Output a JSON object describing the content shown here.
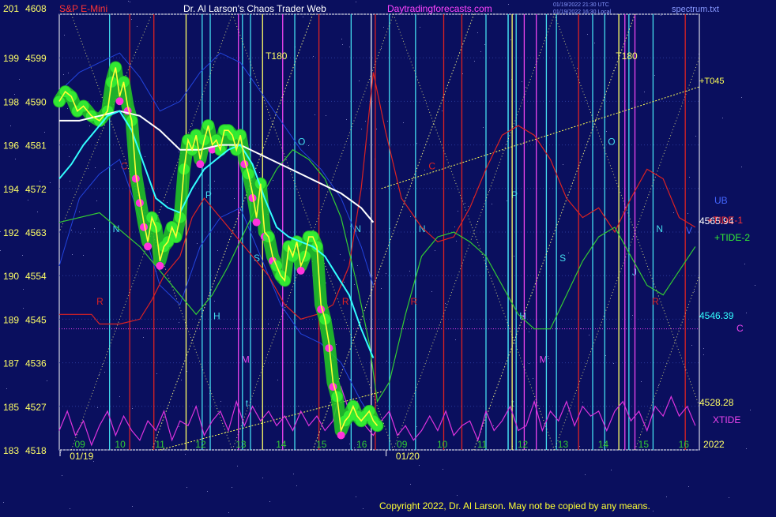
{
  "header": {
    "symbol": "S&P E-Mini",
    "title": "Dr. Al Larson's Chaos Trader Web",
    "site": "Daytradingforecasts.com",
    "stamp1": "01/19/2022 21:30 UTC",
    "stamp2": "01/19/2022 16:30 Local",
    "file": "spectrum.txt"
  },
  "footer": {
    "copyright": "Copyright 2022, Dr. Al Larson. May not be copied by any means."
  },
  "colors": {
    "background": "#0a0f5e",
    "grid": "#2a3a9a",
    "price": "#ffff33",
    "halo": "#22cc22",
    "ma_fast": "#33ffff",
    "ma_slow": "#ffffff",
    "tide1": "#dd2222",
    "tide2": "#33cc33",
    "xtide": "#dd33dd",
    "band": "#2244dd",
    "sun_line": "#44ddee",
    "moon_line": "#ee44ee",
    "mercury_line": "#dd2222",
    "venus_line": "#ffff66"
  },
  "chart_data": {
    "type": "line",
    "title": "S&P E-Mini",
    "y_left_ticks": [
      "183",
      "185",
      "187",
      "189",
      "190",
      "192",
      "194",
      "196",
      "198",
      "199",
      "201"
    ],
    "y_price_ticks": [
      4518,
      4527,
      4536,
      4545,
      4554,
      4563,
      4572,
      4581,
      4590,
      4599,
      4608
    ],
    "ylim": [
      4518,
      4608
    ],
    "x_hour_labels": [
      {
        "t": 0.5,
        "label": "09"
      },
      {
        "t": 1.5,
        "label": "10"
      },
      {
        "t": 2.5,
        "label": "11"
      },
      {
        "t": 3.5,
        "label": "12"
      },
      {
        "t": 4.5,
        "label": "13"
      },
      {
        "t": 5.5,
        "label": "14"
      },
      {
        "t": 6.5,
        "label": "15"
      },
      {
        "t": 7.5,
        "label": "16"
      },
      {
        "t": 8.5,
        "label": "09"
      },
      {
        "t": 9.5,
        "label": "10"
      },
      {
        "t": 10.5,
        "label": "11"
      },
      {
        "t": 11.5,
        "label": "12"
      },
      {
        "t": 12.5,
        "label": "13"
      },
      {
        "t": 13.5,
        "label": "14"
      },
      {
        "t": 14.5,
        "label": "15"
      },
      {
        "t": 15.5,
        "label": "16"
      }
    ],
    "x_range": [
      0,
      15.9
    ],
    "dates": [
      {
        "t": 0.3,
        "label": "01/19"
      },
      {
        "t": 8.4,
        "label": "01/20"
      }
    ],
    "year": "2022",
    "price": {
      "name": "price",
      "x": [
        0,
        0.15,
        0.3,
        0.45,
        0.6,
        0.8,
        1.0,
        1.2,
        1.3,
        1.4,
        1.5,
        1.6,
        1.7,
        1.8,
        1.9,
        2.0,
        2.1,
        2.2,
        2.3,
        2.4,
        2.5,
        2.6,
        2.7,
        2.8,
        2.9,
        3.0,
        3.1,
        3.2,
        3.3,
        3.4,
        3.5,
        3.6,
        3.7,
        3.8,
        3.9,
        4.0,
        4.1,
        4.2,
        4.3,
        4.4,
        4.5,
        4.6,
        4.7,
        4.8,
        4.9,
        5.0,
        5.1,
        5.2,
        5.3,
        5.4,
        5.5,
        5.6,
        5.7,
        5.8,
        5.9,
        6.0,
        6.1,
        6.2,
        6.3,
        6.4,
        6.5,
        6.6,
        6.7,
        6.8,
        6.9,
        7.0,
        7.1,
        7.2,
        7.3,
        7.4,
        7.5,
        7.6,
        7.7,
        7.8,
        7.9
      ],
      "y": [
        4590,
        4592,
        4591,
        4588,
        4589,
        4587,
        4586,
        4588,
        4594,
        4597,
        4591,
        4594,
        4589,
        4586,
        4575,
        4570,
        4565,
        4561,
        4566,
        4564,
        4557,
        4560,
        4561,
        4564,
        4562,
        4566,
        4576,
        4582,
        4580,
        4583,
        4578,
        4582,
        4585,
        4581,
        4582,
        4580,
        4584,
        4584,
        4583,
        4580,
        4583,
        4578,
        4575,
        4571,
        4566,
        4573,
        4563,
        4562,
        4558,
        4556,
        4554,
        4553,
        4560,
        4558,
        4561,
        4556,
        4558,
        4562,
        4562,
        4560,
        4548,
        4545,
        4540,
        4532,
        4529,
        4522,
        4524,
        4525,
        4527,
        4525,
        4524,
        4525,
        4526,
        4524,
        4523
      ]
    },
    "ma_fast": {
      "name": "ma_fast",
      "x": [
        0,
        0.3,
        0.6,
        0.9,
        1.2,
        1.5,
        1.8,
        2.1,
        2.4,
        2.7,
        3.0,
        3.3,
        3.6,
        3.9,
        4.2,
        4.5,
        4.8,
        5.1,
        5.4,
        5.7,
        6.0,
        6.3,
        6.6,
        6.9,
        7.2,
        7.5,
        7.8
      ],
      "y": [
        4574,
        4577,
        4581,
        4584,
        4587,
        4588,
        4584,
        4577,
        4570,
        4568,
        4567,
        4572,
        4576,
        4578,
        4580,
        4581,
        4577,
        4570,
        4564,
        4562,
        4561,
        4560,
        4558,
        4554,
        4550,
        4543,
        4537
      ]
    },
    "ma_slow": {
      "name": "ma_slow",
      "x": [
        0,
        0.5,
        1.0,
        1.5,
        2.0,
        2.5,
        3.0,
        3.5,
        4.0,
        4.5,
        5.0,
        5.5,
        6.0,
        6.5,
        7.0,
        7.5,
        7.8
      ],
      "y": [
        4586,
        4586,
        4587,
        4588,
        4587,
        4584,
        4580,
        4580,
        4581,
        4581,
        4579,
        4577,
        4575,
        4573,
        4571,
        4568,
        4565
      ]
    },
    "tide1": {
      "name": "+TIDE-1",
      "x": [
        0,
        0.8,
        1.0,
        1.5,
        2.0,
        2.3,
        2.6,
        3.0,
        3.3,
        3.6,
        4.0,
        4.4,
        4.8,
        5.2,
        5.6,
        6.0,
        6.4,
        6.8,
        7.2,
        7.5,
        7.8,
        8.1,
        8.5,
        9.0,
        9.4,
        9.8,
        10.2,
        10.6,
        11.0,
        11.4,
        11.8,
        12.2,
        12.6,
        13.0,
        13.4,
        13.8,
        14.2,
        14.6,
        15.0,
        15.4,
        15.8
      ],
      "y": [
        4546,
        4546,
        4544,
        4544,
        4545,
        4549,
        4554,
        4558,
        4566,
        4570,
        4566,
        4562,
        4558,
        4554,
        4548,
        4545,
        4546,
        4548,
        4556,
        4572,
        4596,
        4584,
        4570,
        4564,
        4561,
        4562,
        4568,
        4576,
        4583,
        4585,
        4583,
        4578,
        4570,
        4566,
        4568,
        4563,
        4570,
        4576,
        4574,
        4566,
        4564
      ]
    },
    "tide2": {
      "name": "+TIDE-2",
      "x": [
        0,
        1.0,
        2.0,
        2.6,
        3.0,
        3.4,
        3.8,
        4.2,
        4.6,
        5.0,
        5.4,
        5.8,
        6.2,
        6.6,
        7.0,
        7.4,
        7.7,
        7.9,
        8.2,
        8.6,
        9.0,
        9.4,
        9.8,
        10.2,
        10.6,
        11.0,
        11.4,
        11.8,
        12.2,
        12.6,
        13.0,
        13.4,
        13.8,
        14.2,
        14.6,
        15.0,
        15.4,
        15.8
      ],
      "y": [
        4565,
        4567,
        4560,
        4554,
        4550,
        4546,
        4550,
        4556,
        4563,
        4570,
        4576,
        4580,
        4578,
        4574,
        4566,
        4552,
        4540,
        4528,
        4532,
        4546,
        4558,
        4562,
        4563,
        4561,
        4558,
        4552,
        4546,
        4543,
        4543,
        4550,
        4557,
        4562,
        4564,
        4558,
        4552,
        4550,
        4555,
        4560
      ]
    },
    "xtide": {
      "name": "XTIDE",
      "x": [
        0,
        0.2,
        0.4,
        0.6,
        0.8,
        1.0,
        1.2,
        1.4,
        1.6,
        1.8,
        2.0,
        2.2,
        2.4,
        2.6,
        2.8,
        3.0,
        3.2,
        3.4,
        3.6,
        3.8,
        4.0,
        4.2,
        4.4,
        4.6,
        4.8,
        5.0,
        5.2,
        5.4,
        5.6,
        5.8,
        6.0,
        6.2,
        6.4,
        6.6,
        6.8,
        7.0,
        7.2,
        7.4,
        7.6,
        7.8,
        8.0,
        8.2,
        8.4,
        8.6,
        8.8,
        9.0,
        9.2,
        9.4,
        9.6,
        9.8,
        10.0,
        10.2,
        10.4,
        10.6,
        10.8,
        11.0,
        11.2,
        11.4,
        11.6,
        11.8,
        12.0,
        12.2,
        12.4,
        12.6,
        12.8,
        13.0,
        13.2,
        13.4,
        13.6,
        13.8,
        14.0,
        14.2,
        14.4,
        14.6,
        14.8,
        15.0,
        15.2,
        15.4,
        15.6,
        15.8
      ],
      "y": [
        4522,
        4526,
        4521,
        4524,
        4519,
        4523,
        4526,
        4521,
        4525,
        4522,
        4520,
        4524,
        4522,
        4526,
        4520,
        4524,
        4523,
        4527,
        4521,
        4524,
        4526,
        4522,
        4528,
        4523,
        4527,
        4524,
        4526,
        4523,
        4525,
        4522,
        4526,
        4523,
        4525,
        4522,
        4524,
        4531,
        4526,
        4528,
        4523,
        4521,
        4524,
        4526,
        4521,
        4523,
        4520,
        4522,
        4525,
        4522,
        4526,
        4521,
        4523,
        4524,
        4520,
        4526,
        4522,
        4524,
        4527,
        4522,
        4523,
        4528,
        4522,
        4526,
        4524,
        4528,
        4523,
        4527,
        4525,
        4526,
        4522,
        4526,
        4528,
        4524,
        4526,
        4522,
        4527,
        4525,
        4529,
        4525,
        4527,
        4523
      ]
    },
    "band_upper": {
      "name": "UB",
      "x": [
        0,
        0.5,
        1.0,
        1.5,
        2.0,
        2.5,
        3.0,
        3.5,
        4.0,
        4.5,
        5.0,
        5.5,
        6.0,
        6.5,
        7.0,
        7.5,
        7.8
      ],
      "y": [
        4592,
        4596,
        4598,
        4600,
        4595,
        4588,
        4590,
        4596,
        4600,
        4598,
        4592,
        4586,
        4580,
        4576,
        4570,
        4560,
        4552
      ]
    },
    "band_lower": {
      "name": "LB",
      "x": [
        0,
        0.5,
        1.0,
        1.5,
        2.0,
        2.5,
        3.0,
        3.5,
        4.0,
        4.5,
        5.0,
        5.5,
        6.0,
        6.5,
        7.0,
        7.5,
        7.8
      ],
      "y": [
        4556,
        4570,
        4575,
        4578,
        4566,
        4552,
        4548,
        4560,
        4566,
        4568,
        4558,
        4548,
        4542,
        4540,
        4536,
        4528,
        4524
      ]
    },
    "trend_lines": [
      {
        "x": [
          2.5,
          8.0
        ],
        "y": [
          4518,
          4530
        ]
      },
      {
        "x": [
          8.0,
          15.9
        ],
        "y": [
          4572,
          4593
        ]
      }
    ],
    "hline_level": 4543,
    "right_labels": {
      "ub": "UB",
      "tide1": "+TIDE-1",
      "tide2": "+TIDE-2",
      "price1_label": "4565.94",
      "price1_value": 4565.94,
      "price2_label": "4546.39",
      "price2_value": 4546.39,
      "price3_label": "4528.28",
      "price3_value": 4528.28,
      "c_label": "C",
      "xtide": "XTIDE",
      "t045": "+T045",
      "v_label": "V"
    },
    "t180_marks": [
      {
        "t": 5.4,
        "label": "T180"
      },
      {
        "t": 14.1,
        "label": "T180"
      }
    ],
    "vlines": [
      {
        "t": 1.25,
        "kind": "sun",
        "label": "N",
        "ly": 4563
      },
      {
        "t": 1.75,
        "kind": "mercury",
        "label": "R",
        "ly": 4548
      },
      {
        "t": 2.35,
        "kind": "mercury",
        "label": "C",
        "ly": 4576
      },
      {
        "t": 3.15,
        "kind": "venus",
        "label": "",
        "ly": 0
      },
      {
        "t": 3.55,
        "kind": "sun",
        "label": "P",
        "ly": 4570
      },
      {
        "t": 3.75,
        "kind": "sun",
        "label": "H",
        "ly": 4545
      },
      {
        "t": 4.45,
        "kind": "moon",
        "label": "M",
        "ly": 4536
      },
      {
        "t": 4.55,
        "kind": "sun",
        "label": "t",
        "ly": 4527
      },
      {
        "t": 4.75,
        "kind": "sun",
        "label": "S",
        "ly": 4557
      },
      {
        "t": 5.05,
        "kind": "venus",
        "label": "",
        "ly": 0
      },
      {
        "t": 5.55,
        "kind": "moon",
        "label": "",
        "ly": 0
      },
      {
        "t": 5.85,
        "kind": "sun",
        "label": "O",
        "ly": 4581
      },
      {
        "t": 6.45,
        "kind": "mercury",
        "label": "",
        "ly": 0
      },
      {
        "t": 7.25,
        "kind": "sun",
        "label": "N",
        "ly": 4563
      },
      {
        "t": 7.85,
        "kind": "mercury",
        "label": "R",
        "ly": 4548
      },
      {
        "t": 8.2,
        "kind": "sun",
        "label": "",
        "ly": 0
      },
      {
        "t": 8.85,
        "kind": "sun",
        "label": "N",
        "ly": 4563
      },
      {
        "t": 9.55,
        "kind": "mercury",
        "label": "R",
        "ly": 4548
      },
      {
        "t": 10.0,
        "kind": "mercury",
        "label": "C",
        "ly": 4576
      },
      {
        "t": 10.6,
        "kind": "sun",
        "label": "",
        "ly": 0
      },
      {
        "t": 11.15,
        "kind": "sun",
        "label": "P",
        "ly": 4570
      },
      {
        "t": 11.35,
        "kind": "sun",
        "label": "H",
        "ly": 4545
      },
      {
        "t": 11.15,
        "kind": "sun",
        "label": "t",
        "ly": 4527
      },
      {
        "t": 11.25,
        "kind": "venus",
        "label": "",
        "ly": 0
      },
      {
        "t": 11.55,
        "kind": "moon",
        "label": "",
        "ly": 0
      },
      {
        "t": 11.85,
        "kind": "moon",
        "label": "M",
        "ly": 4536
      },
      {
        "t": 12.1,
        "kind": "sun",
        "label": "",
        "ly": 0
      },
      {
        "t": 12.35,
        "kind": "sun",
        "label": "S",
        "ly": 4557
      },
      {
        "t": 12.9,
        "kind": "mercury",
        "label": "",
        "ly": 0
      },
      {
        "t": 13.25,
        "kind": "sun",
        "label": "",
        "ly": 0
      },
      {
        "t": 13.55,
        "kind": "sun",
        "label": "O",
        "ly": 4581
      },
      {
        "t": 13.9,
        "kind": "venus",
        "label": "",
        "ly": 0
      },
      {
        "t": 14.05,
        "kind": "moon",
        "label": "",
        "ly": 0
      },
      {
        "t": 14.15,
        "kind": "sun",
        "label": "J",
        "ly": 4554
      },
      {
        "t": 14.3,
        "kind": "moon",
        "label": "",
        "ly": 0
      },
      {
        "t": 14.75,
        "kind": "sun",
        "label": "N",
        "ly": 4563
      },
      {
        "t": 15.55,
        "kind": "mercury",
        "label": "R",
        "ly": 4548
      }
    ],
    "grid": true,
    "legend": "right"
  }
}
